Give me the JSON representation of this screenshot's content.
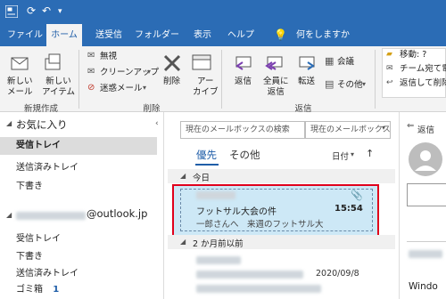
{
  "ribbon_tabs": [
    "ファイル",
    "ホーム",
    "送受信",
    "フォルダー",
    "表示",
    "ヘルプ",
    "何をしますか"
  ],
  "ribbon": {
    "new_mail": "新しい\nメール",
    "new_items": "新しい\nアイテム",
    "group_new": "新規作成",
    "ignore": "無視",
    "cleanup": "クリーンアップ",
    "junk": "迷惑メール",
    "delete": "削除",
    "archive": "アー\nカイブ",
    "group_delete": "削除",
    "reply": "返信",
    "reply_all": "全員に\n返信",
    "forward": "転送",
    "meeting": "会議",
    "more": "その他",
    "group_reply": "返信",
    "move_to": "移動: ?",
    "team_email": "チーム宛て電",
    "reply_delete": "返信して削除"
  },
  "folders": {
    "favorites_header": "お気に入り",
    "fav_items": [
      "受信トレイ",
      "送信済みトレイ",
      "下書き"
    ],
    "account": "@outlook.jp",
    "account_items": [
      "受信トレイ",
      "下書き",
      "送信済みトレイ"
    ],
    "trash": "ゴミ箱",
    "trash_count": "1"
  },
  "list": {
    "search_placeholder": "現在のメールボックスの検索",
    "scope": "現在のメールボックス",
    "tab_focused": "優先",
    "tab_other": "その他",
    "sort": "日付",
    "sort_dir": "↑",
    "group_today": "今日",
    "msg_subject": "フットサル大会の件",
    "msg_time": "15:54",
    "msg_preview": "一郎さんへ　来週のフットサル大",
    "group_older": "2 か月前以前",
    "msg2_date": "2020/09/8"
  },
  "reading": {
    "reply": "返信",
    "windows": "Windo"
  }
}
